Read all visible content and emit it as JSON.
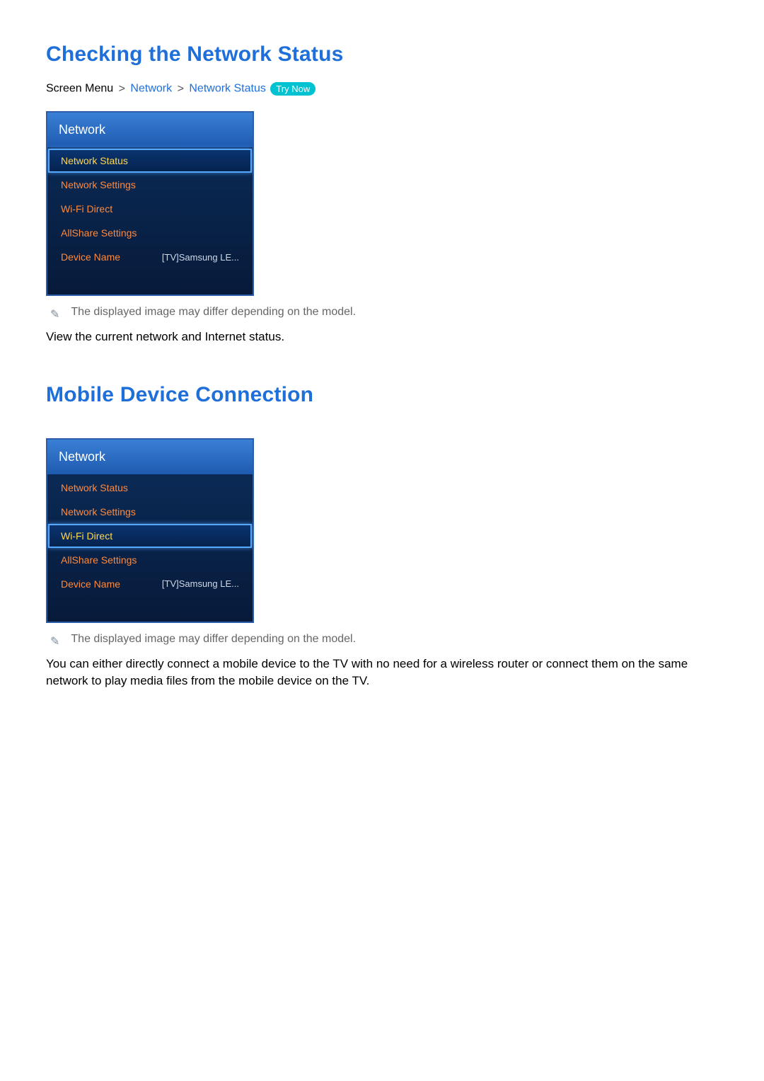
{
  "section1": {
    "heading": "Checking the Network Status",
    "breadcrumb": {
      "prefix": "Screen Menu",
      "sep1": ">",
      "link1": "Network",
      "sep2": ">",
      "link2": "Network Status",
      "try_now": "Try Now"
    },
    "menu": {
      "title": "Network",
      "items": [
        {
          "label": "Network Status",
          "value": "",
          "selected": true
        },
        {
          "label": "Network Settings",
          "value": "",
          "selected": false
        },
        {
          "label": "Wi-Fi Direct",
          "value": "",
          "selected": false
        },
        {
          "label": "AllShare Settings",
          "value": "",
          "selected": false
        },
        {
          "label": "Device Name",
          "value": "[TV]Samsung LE...",
          "selected": false
        }
      ]
    },
    "note_icon": "✎",
    "note_text": "The displayed image may differ depending on the model.",
    "body": "View the current network and Internet status."
  },
  "section2": {
    "heading": "Mobile Device Connection",
    "menu": {
      "title": "Network",
      "items": [
        {
          "label": "Network Status",
          "value": "",
          "selected": false
        },
        {
          "label": "Network Settings",
          "value": "",
          "selected": false
        },
        {
          "label": "Wi-Fi Direct",
          "value": "",
          "selected": true
        },
        {
          "label": "AllShare Settings",
          "value": "",
          "selected": false
        },
        {
          "label": "Device Name",
          "value": "[TV]Samsung LE...",
          "selected": false
        }
      ]
    },
    "note_icon": "✎",
    "note_text": "The displayed image may differ depending on the model.",
    "body": "You can either directly connect a mobile device to the TV with no need for a wireless router or connect them on the same network to play media files from the mobile device on the TV."
  }
}
